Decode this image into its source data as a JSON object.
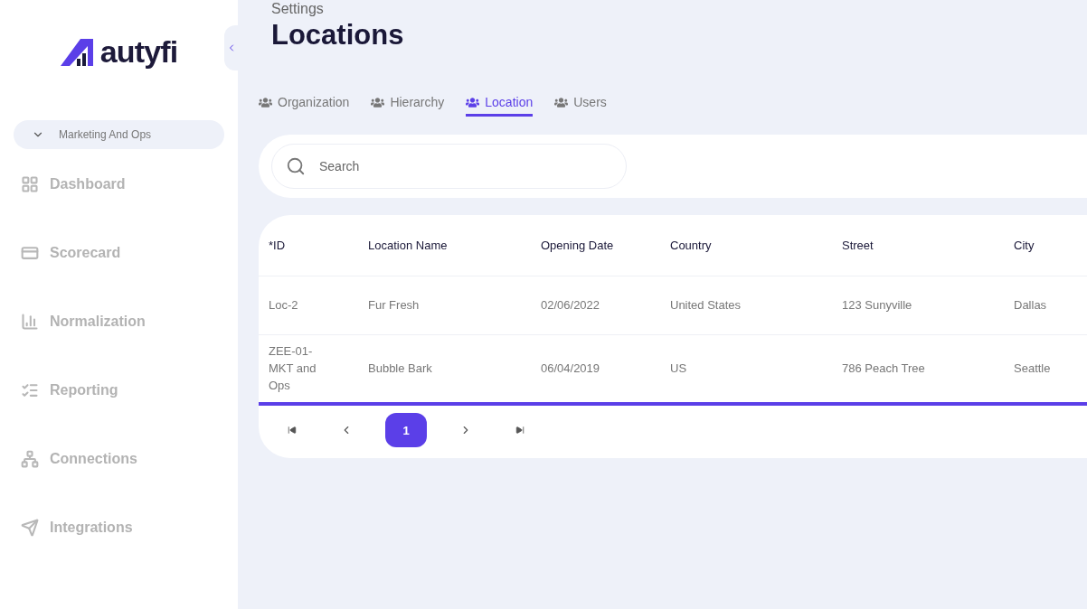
{
  "sidebar": {
    "logo": "autyfi",
    "workspace": "Marketing And Ops",
    "items": [
      {
        "label": "Dashboard",
        "kind": "dashboard"
      },
      {
        "label": "Scorecard",
        "kind": "scorecard"
      },
      {
        "label": "Normalization",
        "kind": "normalization"
      },
      {
        "label": "Reporting",
        "kind": "reporting"
      },
      {
        "label": "Connections",
        "kind": "connections"
      },
      {
        "label": "Integrations",
        "kind": "integrations"
      }
    ]
  },
  "header": {
    "breadcrumb": "Settings",
    "title": "Locations"
  },
  "tabs": [
    {
      "label": "Organization",
      "selected": false
    },
    {
      "label": "Hierarchy",
      "selected": false
    },
    {
      "label": "Location",
      "selected": true
    },
    {
      "label": "Users",
      "selected": false
    }
  ],
  "search": {
    "placeholder": "Search"
  },
  "table": {
    "columns": [
      "*ID",
      "Location Name",
      "Opening Date",
      "Country",
      "Street",
      "City"
    ],
    "rows": [
      [
        "Loc-2",
        "Fur Fresh",
        "02/06/2022",
        "United States",
        "123 Sunyville",
        "Dallas"
      ],
      [
        "ZEE-01-MKT and Ops",
        "Bubble Bark",
        "06/04/2019",
        "US",
        "786 Peach Tree",
        "Seattle"
      ]
    ]
  },
  "pagination": {
    "pages": [
      {
        "label": "1",
        "selected": true
      }
    ]
  }
}
